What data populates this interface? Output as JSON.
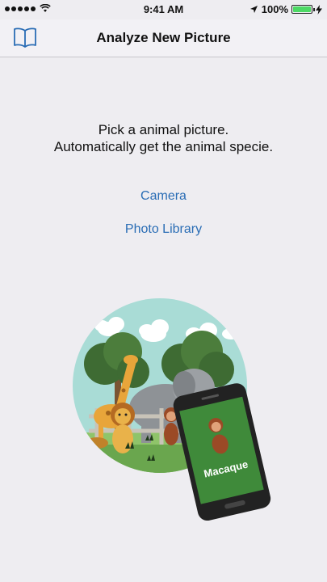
{
  "status_bar": {
    "time": "9:41 AM",
    "battery": "100%",
    "battery_level": 1.0
  },
  "nav": {
    "title": "Analyze New Picture",
    "left_icon": "book-icon"
  },
  "instructions": {
    "line1": "Pick a animal picture.",
    "line2": "Automatically get the animal specie."
  },
  "actions": {
    "camera": "Camera",
    "photo_library": "Photo Library"
  },
  "illustration": {
    "phone_label": "Macaque"
  },
  "colors": {
    "link": "#2a6db5",
    "background": "#eeedf1",
    "phone_screen": "#3f8a3a"
  }
}
